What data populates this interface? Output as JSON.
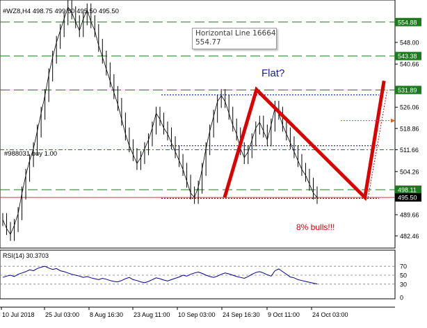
{
  "chart": {
    "header": "#WZ8,H4  498.75 499.80 495.50 495.50",
    "hline_tooltip": {
      "name": "Horizontal Line 16664",
      "value": "554.77"
    },
    "order_label": "#988031 buy 1.00",
    "annotation_flat": "Flat?",
    "annotation_bulls": "8% bulls!!!",
    "price_axis_labels": [
      {
        "text": "548.00",
        "value": 548.0
      },
      {
        "text": "540.66",
        "value": 540.66
      },
      {
        "text": "526.06",
        "value": 526.06
      },
      {
        "text": "518.86",
        "value": 518.86
      },
      {
        "text": "511.66",
        "value": 511.66
      },
      {
        "text": "504.26",
        "value": 504.26
      },
      {
        "text": "489.66",
        "value": 489.66
      },
      {
        "text": "482.46",
        "value": 482.46
      }
    ],
    "level_badges": [
      {
        "text": "554.88",
        "value": 554.88,
        "color": "#1e7a1e"
      },
      {
        "text": "543.38",
        "value": 543.38,
        "color": "#1e7a1e"
      },
      {
        "text": "531.89",
        "value": 531.89,
        "color": "#1e7a1e"
      },
      {
        "text": "498.11",
        "value": 498.11,
        "color": "#1e7a1e"
      },
      {
        "text": "495.50",
        "value": 495.5,
        "color": "#000000"
      }
    ],
    "rsi_label": "RSI(14) 30.3703",
    "rsi_axis_labels": [
      {
        "text": "70",
        "value": 70
      },
      {
        "text": "50",
        "value": 50
      },
      {
        "text": "30",
        "value": 30
      },
      {
        "text": "0",
        "value": 0
      }
    ],
    "time_labels": [
      "10 Jul 2018",
      "25 Jul 03:00",
      "8 Aug 16:30",
      "23 Aug 11:00",
      "10 Sep 03:00",
      "24 Sep 16:30",
      "9 Oct 11:00",
      "24 Oct 03:00"
    ],
    "colors": {
      "candles": "#000000",
      "level_lines": "#1e7a1e",
      "order_line": "#1e7a1e",
      "range_lines": "#00008b",
      "pattern": "#dd0000",
      "projection": "#dd0000",
      "rsi": "#00008b",
      "annotation_flat": "#1a1aa0",
      "annotation_bulls": "#dd0000"
    }
  },
  "chart_data": {
    "type": "candlestick",
    "symbol": "#WZ8",
    "timeframe": "H4",
    "y_range": [
      480.0,
      560.0
    ],
    "rsi_range": [
      0,
      100
    ],
    "levels": [
      554.88,
      543.38,
      531.89,
      498.11,
      495.5
    ],
    "order_level": 511.66,
    "range_lines": [
      530.2,
      513.0,
      495.2
    ],
    "pattern_points": [
      {
        "date": "2018-09-10",
        "price": 495.5
      },
      {
        "date": "2018-09-20",
        "price": 532.0
      },
      {
        "date": "2018-10-24",
        "price": 495.5
      },
      {
        "date": "2018-10-30",
        "price": 535.0
      }
    ],
    "projection_points": [
      {
        "date": "2018-10-25",
        "price": 495.5
      },
      {
        "date": "2018-10-31",
        "price": 532.0
      }
    ],
    "closes": [
      488,
      485,
      483,
      486,
      490,
      497,
      503,
      508,
      512,
      518,
      524,
      530,
      537,
      543,
      548,
      552,
      556,
      560,
      558,
      555,
      552,
      556,
      559,
      555,
      552,
      547,
      543,
      539,
      535,
      531,
      527,
      522,
      517,
      513,
      510,
      507,
      509,
      512,
      515,
      519,
      524,
      522,
      519,
      517,
      514,
      511,
      508,
      505,
      501,
      497,
      495.5,
      499,
      505,
      512,
      518,
      523,
      528,
      530,
      528,
      524,
      520,
      517,
      512,
      509,
      511,
      515,
      519,
      521,
      518,
      515,
      520,
      526,
      524,
      520,
      517,
      514,
      511,
      508,
      505,
      503,
      500,
      497,
      495.5
    ],
    "rsi": [
      45,
      48,
      50,
      47,
      52,
      55,
      58,
      62,
      60,
      65,
      68,
      70,
      66,
      63,
      65,
      60,
      58,
      55,
      52,
      50,
      48,
      45,
      47,
      44,
      42,
      40,
      43,
      41,
      38,
      36,
      35,
      38,
      42,
      45,
      40,
      38,
      35,
      33,
      36,
      40,
      44,
      42,
      39,
      37,
      40,
      43,
      46,
      50,
      48,
      52,
      55,
      57,
      54,
      50,
      47,
      45,
      48,
      52,
      55,
      53,
      50,
      47,
      45,
      43,
      47,
      52,
      56,
      58,
      55,
      51,
      48,
      60,
      64,
      58,
      52,
      46,
      44,
      40,
      38,
      36,
      34,
      32,
      30.3703
    ]
  }
}
